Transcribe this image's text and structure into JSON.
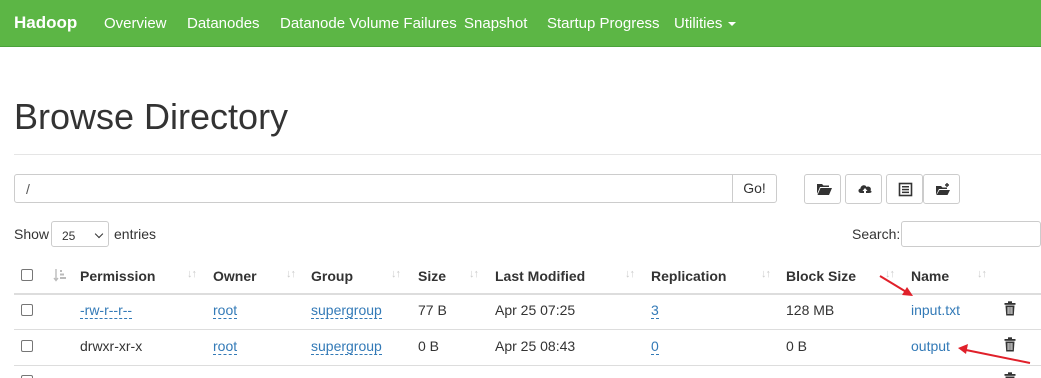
{
  "navbar": {
    "brand": "Hadoop",
    "items": [
      "Overview",
      "Datanodes",
      "Datanode Volume Failures",
      "Snapshot",
      "Startup Progress",
      "Utilities"
    ]
  },
  "page": {
    "title": "Browse Directory"
  },
  "path_bar": {
    "value": "/",
    "go_label": "Go!"
  },
  "toolbar": {
    "icons": [
      "folder-open-icon",
      "cloud-upload-icon",
      "list-icon",
      "folder-add-icon"
    ]
  },
  "table_controls": {
    "show_label": "Show",
    "entries_value": "25",
    "entries_label": "entries",
    "search_label": "Search:"
  },
  "table": {
    "columns": [
      "Permission",
      "Owner",
      "Group",
      "Size",
      "Last Modified",
      "Replication",
      "Block Size",
      "Name"
    ],
    "rows": [
      {
        "permission": "-rw-r--r--",
        "owner": "root",
        "group": "supergroup",
        "size": "77 B",
        "last_modified": "Apr 25 07:25",
        "replication": "3",
        "block_size": "128 MB",
        "name": "input.txt"
      },
      {
        "permission": "drwxr-xr-x",
        "owner": "root",
        "group": "supergroup",
        "size": "0 B",
        "last_modified": "Apr 25 08:43",
        "replication": "0",
        "block_size": "0 B",
        "name": "output"
      }
    ]
  },
  "colors": {
    "navbar_bg": "#5cb645",
    "link": "#337ab7",
    "annotation_arrow": "#e0202a"
  }
}
